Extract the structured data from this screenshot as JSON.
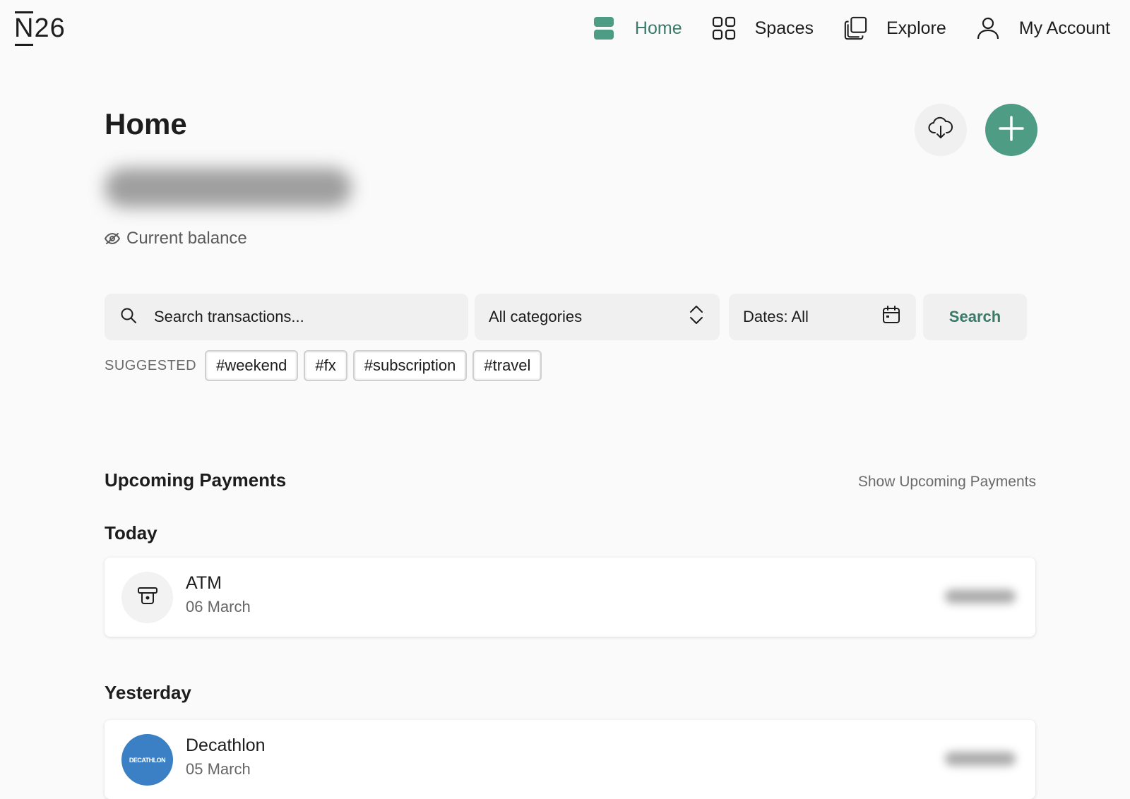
{
  "brand": {
    "logo_n": "N",
    "logo_num": "26"
  },
  "nav": {
    "items": [
      {
        "label": "Home",
        "icon": "home-icon",
        "active": true
      },
      {
        "label": "Spaces",
        "icon": "grid-icon"
      },
      {
        "label": "Explore",
        "icon": "copy-icon"
      },
      {
        "label": "My Account",
        "icon": "user-icon"
      }
    ]
  },
  "header": {
    "title": "Home",
    "balance_label": "Current balance"
  },
  "filters": {
    "search_placeholder": "Search transactions...",
    "category": "All categories",
    "dates": "Dates: All",
    "search_button": "Search",
    "suggested_label": "SUGGESTED",
    "tags": [
      "#weekend",
      "#fx",
      "#subscription",
      "#travel"
    ]
  },
  "upcoming": {
    "title": "Upcoming Payments",
    "show_link": "Show Upcoming Payments",
    "groups": [
      {
        "day": "Today",
        "items": [
          {
            "name": "ATM",
            "date": "06 March",
            "icon": "atm-icon"
          }
        ]
      },
      {
        "day": "Yesterday",
        "items": [
          {
            "name": "Decathlon",
            "date": "05 March",
            "logo_text": "DECATHLON"
          }
        ]
      }
    ]
  },
  "colors": {
    "accent": "#4f9c84",
    "accent_text": "#3a7a68",
    "decathlon": "#3b7fc4"
  }
}
